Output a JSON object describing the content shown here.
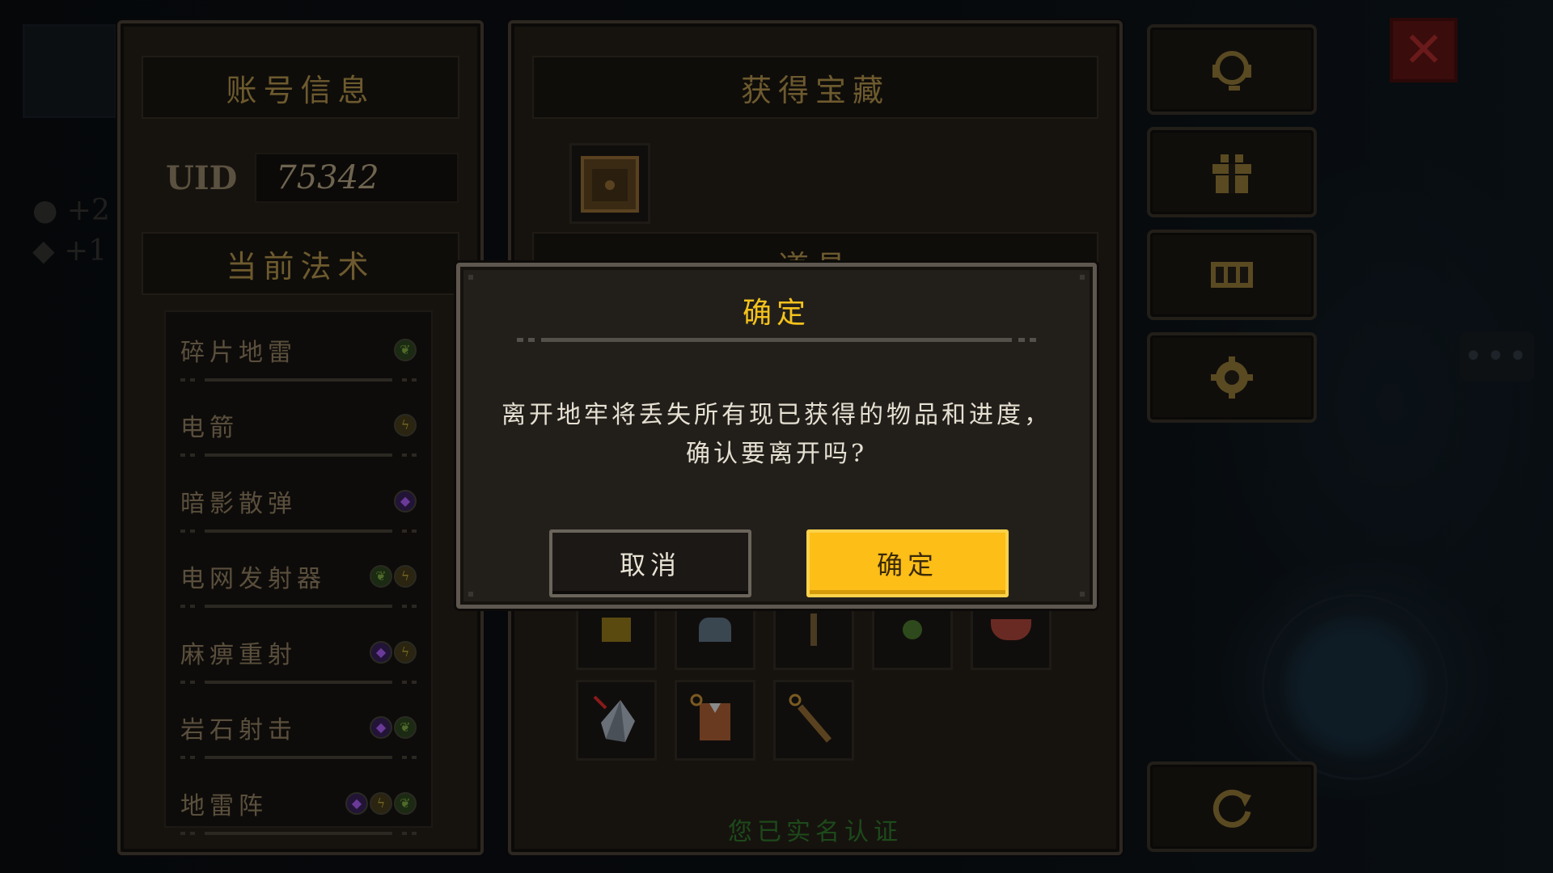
{
  "account": {
    "title": "账号信息",
    "uid_label": "UID",
    "uid_value": "75342",
    "spells_title": "当前法术"
  },
  "spells": [
    {
      "name": "碎片地雷",
      "elements": [
        "green"
      ]
    },
    {
      "name": "电箭",
      "elements": [
        "yellow"
      ]
    },
    {
      "name": "暗影散弹",
      "elements": [
        "purple"
      ]
    },
    {
      "name": "电网发射器",
      "elements": [
        "green",
        "yellow"
      ]
    },
    {
      "name": "麻痹重射",
      "elements": [
        "purple",
        "yellow"
      ]
    },
    {
      "name": "岩石射击",
      "elements": [
        "purple",
        "green"
      ]
    },
    {
      "name": "地雷阵",
      "elements": [
        "purple",
        "yellow",
        "green"
      ]
    }
  ],
  "treasure": {
    "title": "获得宝藏",
    "section_label": "道具",
    "verified_text": "您已实名认证"
  },
  "side_buttons": [
    {
      "icon": "support-headset-icon"
    },
    {
      "icon": "gift-icon"
    },
    {
      "icon": "redeem-code-icon"
    },
    {
      "icon": "settings-gear-icon"
    },
    {
      "icon": "refresh-icon"
    }
  ],
  "dialog": {
    "title": "确定",
    "message": "离开地牢将丢失所有现已获得的物品和进度，确认要离开吗?",
    "cancel_label": "取消",
    "confirm_label": "确定"
  },
  "colors": {
    "confirm_button": "#fcbe17",
    "dialog_title": "#f4c21c",
    "verified_text": "#1d4a1a"
  }
}
